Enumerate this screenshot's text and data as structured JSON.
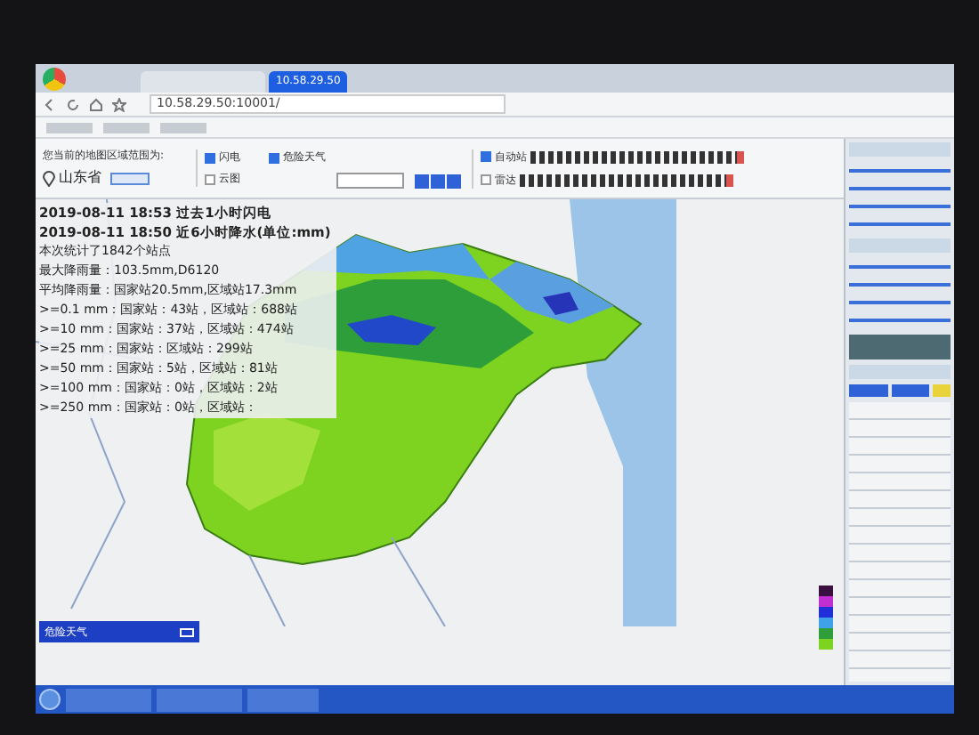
{
  "browser": {
    "tabs": [
      {
        "label": "10.58.29.50",
        "selected": true
      }
    ],
    "address": "10.58.29.50:10001/"
  },
  "region": {
    "label": "您当前的地图区域范围为:",
    "province": "山东省"
  },
  "layers": [
    {
      "label": "闪电",
      "checked": true
    },
    {
      "label": "危险天气",
      "checked": true
    },
    {
      "label": "云图",
      "checked": false
    }
  ],
  "stations": [
    {
      "label": "自动站",
      "checked": true
    },
    {
      "label": "雷达",
      "checked": false
    }
  ],
  "info": {
    "lines": [
      "2019-08-11 18:53 过去1小时闪电",
      "2019-08-11 18:50 近6小时降水(单位:mm)",
      "本次统计了1842个站点",
      "最大降雨量：103.5mm,D6120",
      "平均降雨量：国家站20.5mm,区域站17.3mm"
    ],
    "stats": [
      ">=0.1 mm：国家站：43站，区域站：688站",
      ">=10 mm：国家站：37站，区域站：474站",
      ">=25 mm：国家站：区域站：299站",
      ">=50 mm：国家站：5站，区域站：81站",
      ">=100 mm：国家站：0站，区域站：2站",
      ">=250 mm：国家站：0站，区域站："
    ]
  },
  "alert_panel": {
    "title": "危险天气"
  }
}
